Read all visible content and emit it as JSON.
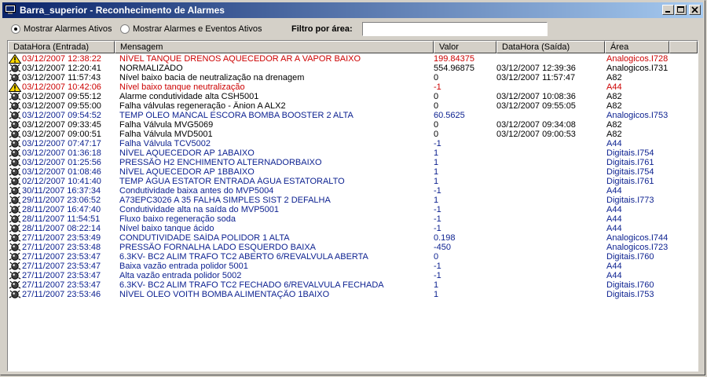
{
  "window": {
    "title": "Barra_superior - Reconhecimento de Alarmes"
  },
  "toolbar": {
    "radio_ativos": "Mostrar Alarmes Ativos",
    "radio_eventos": "Mostrar Alarmes e Eventos Ativos",
    "filtro_label": "Filtro por área:",
    "filtro_value": ""
  },
  "table": {
    "columns": [
      "DataHora (Entrada)",
      "Mensagem",
      "Valor",
      "DataHora (Saída)",
      "Área"
    ],
    "rows": [
      {
        "icon": "warning-icon",
        "color": "#cc0000",
        "entrada": "03/12/2007 12:38:22",
        "mensagem": "NÍVEL TANQUE DRENOS AQUECEDOR  AR A VAPOR BAIXO",
        "valor": "199.84375",
        "saida": "",
        "area": "Analogicos.I728"
      },
      {
        "icon": "alarm-icon",
        "color": "#000000",
        "entrada": "03/12/2007 12:20:41",
        "mensagem": "NORMALIZADO",
        "valor": "554.96875",
        "saida": "03/12/2007 12:39:36",
        "area": "Analogicos.I731"
      },
      {
        "icon": "alarm-icon",
        "color": "#000000",
        "entrada": "03/12/2007 11:57:43",
        "mensagem": "Nível baixo bacia de neutralização na drenagem",
        "valor": "0",
        "saida": "03/12/2007 11:57:47",
        "area": "A82"
      },
      {
        "icon": "warning-icon",
        "color": "#cc0000",
        "entrada": "03/12/2007 10:42:06",
        "mensagem": "Nível baixo tanque neutralização",
        "valor": "-1",
        "saida": "",
        "area": "A44"
      },
      {
        "icon": "alarm-icon",
        "color": "#000000",
        "entrada": "03/12/2007 09:55:12",
        "mensagem": "Alarme condutividade alta CSH5001",
        "valor": "0",
        "saida": "03/12/2007 10:08:36",
        "area": "A82"
      },
      {
        "icon": "alarm-icon",
        "color": "#000000",
        "entrada": "03/12/2007 09:55:00",
        "mensagem": "Falha válvulas regeneração - Ânion A ALX2",
        "valor": "0",
        "saida": "03/12/2007 09:55:05",
        "area": "A82"
      },
      {
        "icon": "alarm-icon",
        "color": "#0a1f8f",
        "entrada": "03/12/2007 09:54:52",
        "mensagem": "TEMP ÓLEO MANCAL ESCORA BOMBA BOOSTER 2 ALTA",
        "valor": "60.5625",
        "saida": "",
        "area": "Analogicos.I753"
      },
      {
        "icon": "alarm-icon",
        "color": "#000000",
        "entrada": "03/12/2007 09:33:45",
        "mensagem": "Falha Válvula MVG5069",
        "valor": "0",
        "saida": "03/12/2007 09:34:08",
        "area": "A82"
      },
      {
        "icon": "alarm-icon",
        "color": "#000000",
        "entrada": "03/12/2007 09:00:51",
        "mensagem": "Falha Válvula MVD5001",
        "valor": "0",
        "saida": "03/12/2007 09:00:53",
        "area": "A82"
      },
      {
        "icon": "alarm-icon",
        "color": "#0a1f8f",
        "entrada": "03/12/2007 07:47:17",
        "mensagem": "Falha Válvula TCV5002",
        "valor": "-1",
        "saida": "",
        "area": "A44"
      },
      {
        "icon": "alarm-icon",
        "color": "#0a1f8f",
        "entrada": "03/12/2007 01:36:18",
        "mensagem": "NÍVEL AQUECEDOR AP 1ABAIXO",
        "valor": "1",
        "saida": "",
        "area": "Digitais.I754"
      },
      {
        "icon": "alarm-icon",
        "color": "#0a1f8f",
        "entrada": "03/12/2007 01:25:56",
        "mensagem": "PRESSÃO H2 ENCHIMENTO ALTERNADORBAIXO",
        "valor": "1",
        "saida": "",
        "area": "Digitais.I761"
      },
      {
        "icon": "alarm-icon",
        "color": "#0a1f8f",
        "entrada": "03/12/2007 01:08:46",
        "mensagem": "NÍVEL AQUECEDOR AP 1BBAIXO",
        "valor": "1",
        "saida": "",
        "area": "Digitais.I754"
      },
      {
        "icon": "alarm-icon",
        "color": "#0a1f8f",
        "entrada": "02/12/2007 10:41:40",
        "mensagem": "TEMP ÁGUA ESTATOR ENTRADA ÁGUA ESTATORALTO",
        "valor": "1",
        "saida": "",
        "area": "Digitais.I761"
      },
      {
        "icon": "alarm-icon",
        "color": "#0a1f8f",
        "entrada": "30/11/2007 16:37:34",
        "mensagem": "Condutividade baixa antes do MVP5004",
        "valor": "-1",
        "saida": "",
        "area": "A44"
      },
      {
        "icon": "alarm-icon",
        "color": "#0a1f8f",
        "entrada": "29/11/2007 23:06:52",
        "mensagem": "A73EPC3026 A 35 FALHA SIMPLES SIST 2 DEFALHA",
        "valor": "1",
        "saida": "",
        "area": "Digitais.I773"
      },
      {
        "icon": "alarm-icon",
        "color": "#0a1f8f",
        "entrada": "28/11/2007 16:47:40",
        "mensagem": "Condutividade alta na saída do MVP5001",
        "valor": "-1",
        "saida": "",
        "area": "A44"
      },
      {
        "icon": "alarm-icon",
        "color": "#0a1f8f",
        "entrada": "28/11/2007 11:54:51",
        "mensagem": "Fluxo baixo regeneração soda",
        "valor": "-1",
        "saida": "",
        "area": "A44"
      },
      {
        "icon": "alarm-icon",
        "color": "#0a1f8f",
        "entrada": "28/11/2007 08:22:14",
        "mensagem": "Nível baixo tanque ácido",
        "valor": "-1",
        "saida": "",
        "area": "A44"
      },
      {
        "icon": "alarm-icon",
        "color": "#0a1f8f",
        "entrada": "27/11/2007 23:53:49",
        "mensagem": "CONDUTIVIDADE SAÍDA POLIDOR 1  ALTA",
        "valor": "0.198",
        "saida": "",
        "area": "Analogicos.I744"
      },
      {
        "icon": "alarm-icon",
        "color": "#0a1f8f",
        "entrada": "27/11/2007 23:53:48",
        "mensagem": "PRESSÃO FORNALHA LADO ESQUERDO BAIXA",
        "valor": "-450",
        "saida": "",
        "area": "Analogicos.I723"
      },
      {
        "icon": "alarm-icon",
        "color": "#0a1f8f",
        "entrada": "27/11/2007 23:53:47",
        "mensagem": "6.3KV- BC2 ALIM TRAFO TC2 ABERTO 6/REVALVULA ABERTA",
        "valor": "0",
        "saida": "",
        "area": "Digitais.I760"
      },
      {
        "icon": "alarm-icon",
        "color": "#0a1f8f",
        "entrada": "27/11/2007 23:53:47",
        "mensagem": "Baixa vazão entrada polidor 5001",
        "valor": "-1",
        "saida": "",
        "area": "A44"
      },
      {
        "icon": "alarm-icon",
        "color": "#0a1f8f",
        "entrada": "27/11/2007 23:53:47",
        "mensagem": "Alta vazão entrada polidor 5002",
        "valor": "-1",
        "saida": "",
        "area": "A44"
      },
      {
        "icon": "alarm-icon",
        "color": "#0a1f8f",
        "entrada": "27/11/2007 23:53:47",
        "mensagem": "6.3KV- BC2 ALIM TRAFO TC2 FECHADO 6/REVALVULA FECHADA",
        "valor": "1",
        "saida": "",
        "area": "Digitais.I760"
      },
      {
        "icon": "alarm-icon",
        "color": "#0a1f8f",
        "entrada": "27/11/2007 23:53:46",
        "mensagem": "NÍVEL ÓLEO VOITH BOMBA ALIMENTAÇÃO 1BAIXO",
        "valor": "1",
        "saida": "",
        "area": "Digitais.I753"
      }
    ]
  }
}
